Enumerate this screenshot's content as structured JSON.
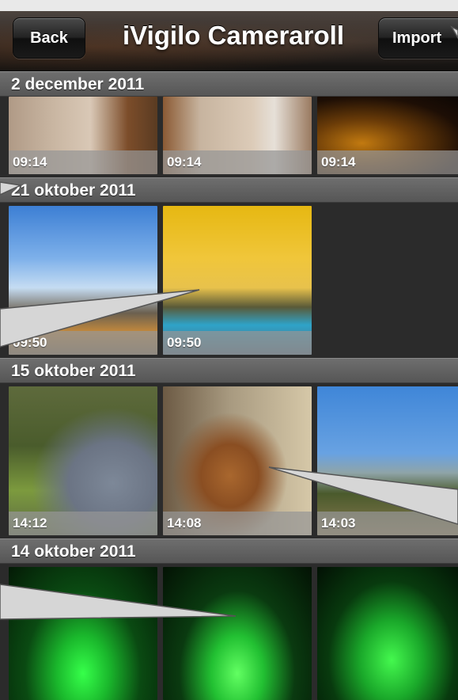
{
  "nav": {
    "back_label": "Back",
    "title": "iVigilo Cameraroll",
    "import_label": "Import"
  },
  "sections": [
    {
      "date": "2 december 2011",
      "photos": [
        {
          "time": "09:14",
          "fill": "p-room1"
        },
        {
          "time": "09:14",
          "fill": "p-room2"
        },
        {
          "time": "09:14",
          "fill": "p-dark"
        }
      ]
    },
    {
      "date": "21 oktober 2011",
      "photos": [
        {
          "time": "09:50",
          "fill": "p-sky1"
        },
        {
          "time": "09:50",
          "fill": "p-sky2"
        }
      ]
    },
    {
      "date": "15 oktober 2011",
      "photos": [
        {
          "time": "14:12",
          "fill": "p-ostrich"
        },
        {
          "time": "14:08",
          "fill": "p-giraffe"
        },
        {
          "time": "14:03",
          "fill": "p-treesky"
        }
      ]
    },
    {
      "date": "14 oktober 2011",
      "photos": [
        {
          "time": "",
          "fill": "p-laser1"
        },
        {
          "time": "",
          "fill": "p-laser2"
        },
        {
          "time": "",
          "fill": "p-laser3"
        }
      ]
    }
  ],
  "colors": {
    "section_header": "#626262",
    "timestamp_bar": "#969696",
    "background": "#2b2b2b",
    "callout": "#d4d4d4"
  }
}
